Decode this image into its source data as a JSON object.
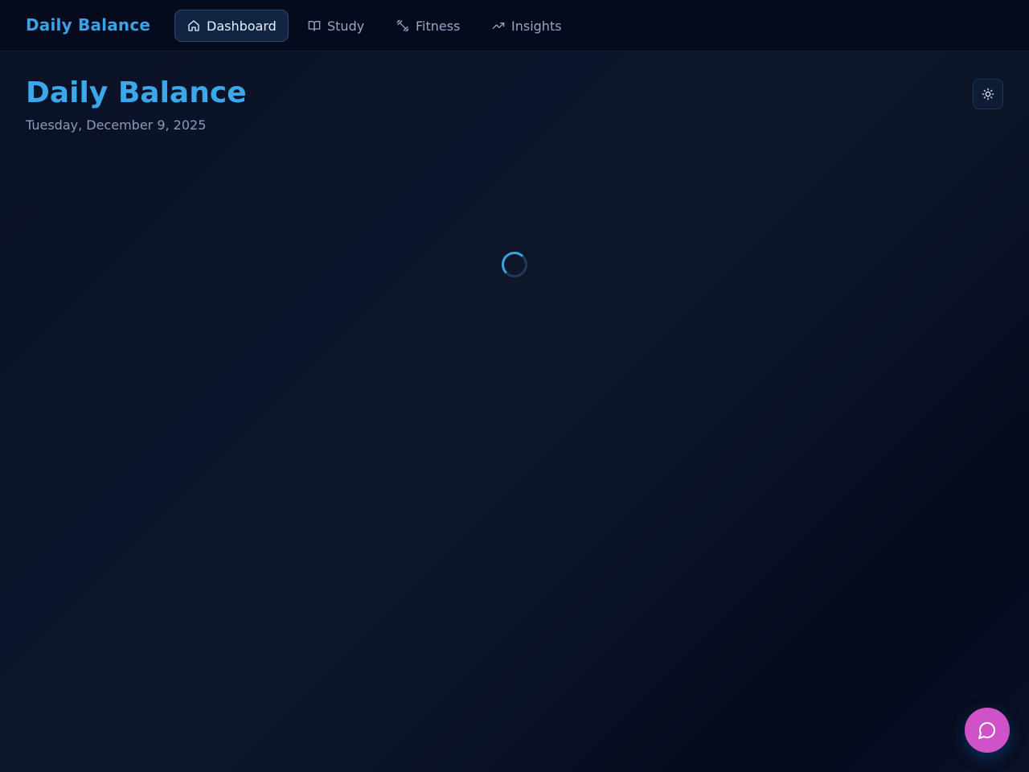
{
  "app": {
    "brand": "Daily Balance"
  },
  "nav": {
    "items": [
      {
        "label": "Dashboard",
        "icon": "home-icon",
        "active": true
      },
      {
        "label": "Study",
        "icon": "book-open-icon",
        "active": false
      },
      {
        "label": "Fitness",
        "icon": "dumbbell-icon",
        "active": false
      },
      {
        "label": "Insights",
        "icon": "trending-up-icon",
        "active": false
      }
    ]
  },
  "header": {
    "title": "Daily Balance",
    "date": "Tuesday, December 9, 2025",
    "theme_toggle_icon": "sun-icon"
  },
  "main": {
    "loading_icon": "loading-spinner-icon"
  },
  "chat": {
    "icon": "message-circle-icon"
  },
  "colors": {
    "accent": "#3aa3e6",
    "background": "#0f172a",
    "topbar": "#050a1d",
    "active_nav_bg": "#112543",
    "muted_text": "#8d9bb8",
    "chat_button": "#cf52c8"
  }
}
